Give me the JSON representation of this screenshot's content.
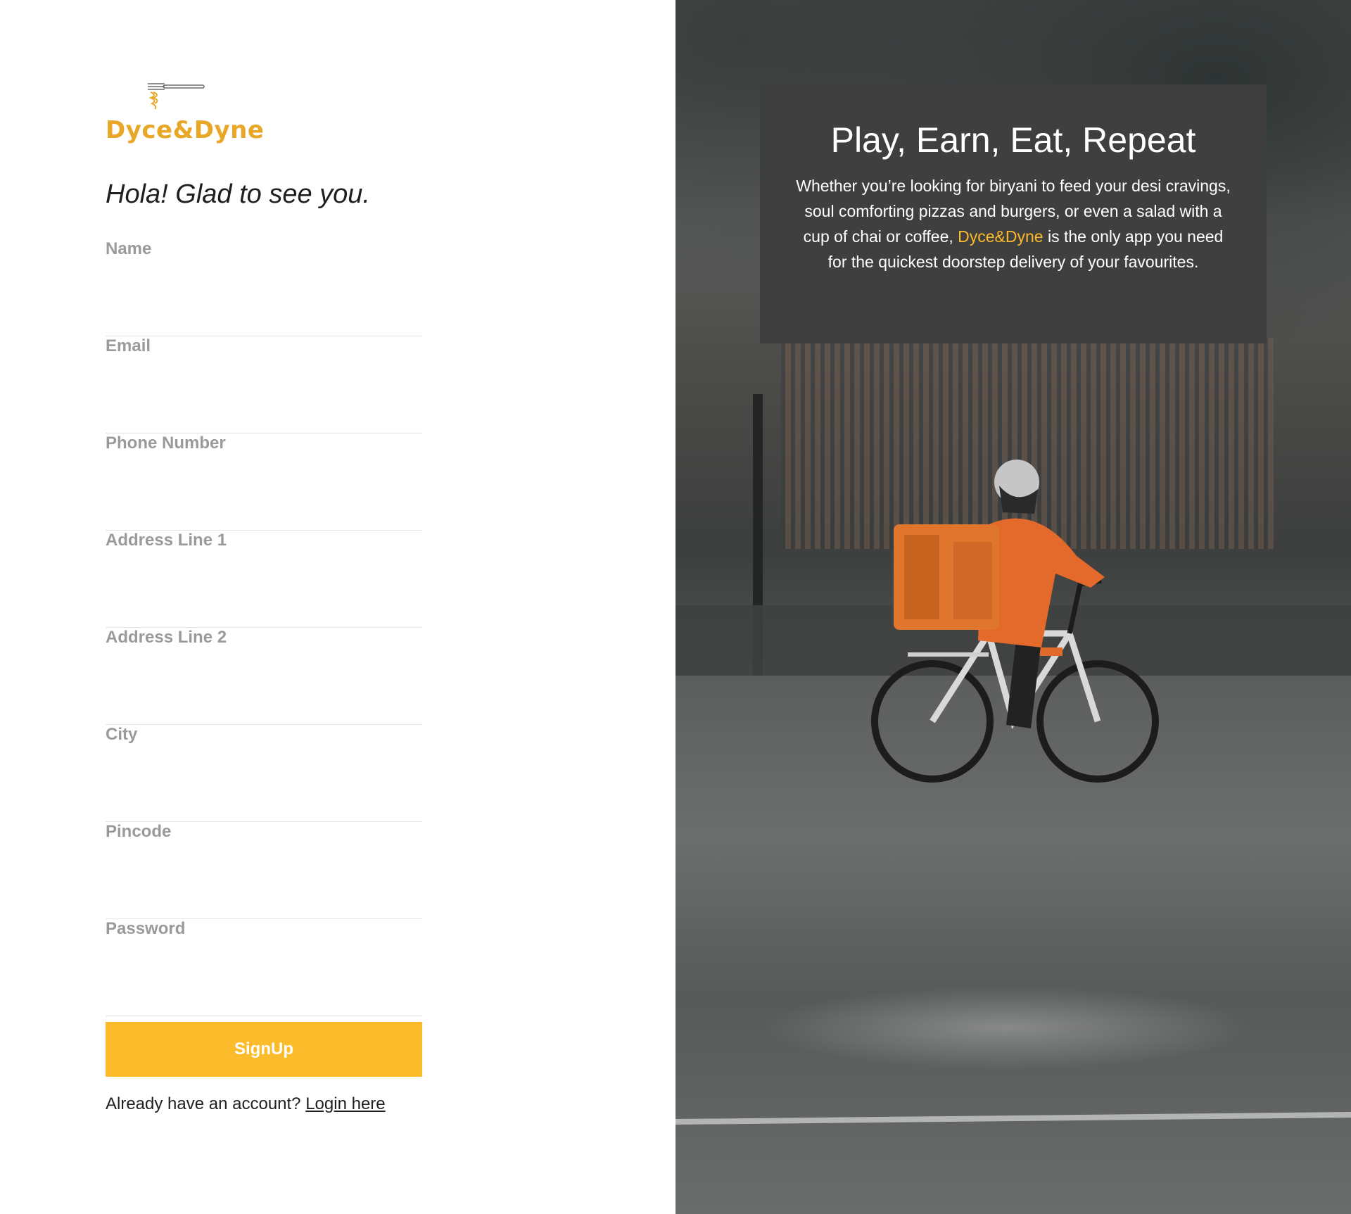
{
  "brand": {
    "name": "Dyce&Dyne",
    "color": "#e8a726"
  },
  "form": {
    "greeting": "Hola! Glad to see you.",
    "fields": [
      {
        "label": "Name",
        "value": ""
      },
      {
        "label": "Email",
        "value": ""
      },
      {
        "label": "Phone Number",
        "value": ""
      },
      {
        "label": "Address Line 1",
        "value": ""
      },
      {
        "label": "Address Line 2",
        "value": ""
      },
      {
        "label": "City",
        "value": ""
      },
      {
        "label": "Pincode",
        "value": ""
      },
      {
        "label": "Password",
        "value": ""
      }
    ],
    "submit_label": "SignUp",
    "submit_color": "#fbbb2a",
    "login_prompt": "Already have an account?",
    "login_link": "Login here"
  },
  "hero": {
    "title": "Play, Earn, Eat, Repeat",
    "desc_before": "Whether you’re looking for biryani to feed your desi cravings, soul comforting pizzas and burgers, or even a salad with a cup of chai or coffee,",
    "desc_brand": "Dyce&Dyne",
    "desc_after": "is the only app you need for the quickest doorstep delivery of your favourites."
  }
}
